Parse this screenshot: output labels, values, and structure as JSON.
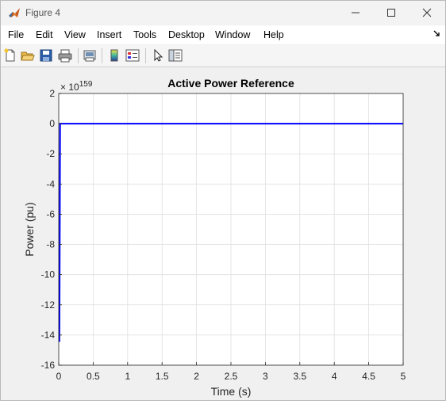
{
  "window": {
    "title": "Figure 4"
  },
  "menu": [
    "File",
    "Edit",
    "View",
    "Insert",
    "Tools",
    "Desktop",
    "Window",
    "Help"
  ],
  "toolbar": {
    "icons": [
      "new-figure-icon",
      "open-file-icon",
      "save-icon",
      "print-icon",
      "print-preview-icon",
      "colorbar-icon",
      "legend-icon",
      "pointer-icon",
      "property-editor-icon"
    ]
  },
  "colors": {
    "line": "#0000ff",
    "grid": "#dfdfdf",
    "background": "#f0f0f0"
  },
  "chart_data": {
    "type": "line",
    "title": "Active Power Reference",
    "xlabel": "Time (s)",
    "ylabel": "Power (pu)",
    "exponent_base": "× 10",
    "exponent_power": "159",
    "xlim": [
      0,
      5
    ],
    "ylim": [
      -16,
      2
    ],
    "xticks": [
      0,
      0.5,
      1,
      1.5,
      2,
      2.5,
      3,
      3.5,
      4,
      4.5,
      5
    ],
    "xtick_labels": [
      "0",
      "0.5",
      "1",
      "1.5",
      "2",
      "2.5",
      "3",
      "3.5",
      "4",
      "4.5",
      "5"
    ],
    "yticks": [
      2,
      0,
      -2,
      -4,
      -6,
      -8,
      -10,
      -12,
      -14,
      -16
    ],
    "ytick_labels": [
      "2",
      "0",
      "-2",
      "-4",
      "-6",
      "-8",
      "-10",
      "-12",
      "-14",
      "-16"
    ],
    "grid": true,
    "series": [
      {
        "x": [
          0,
          0.01,
          0.02,
          5
        ],
        "y": [
          -14.4,
          -14.4,
          0,
          0
        ]
      }
    ]
  }
}
